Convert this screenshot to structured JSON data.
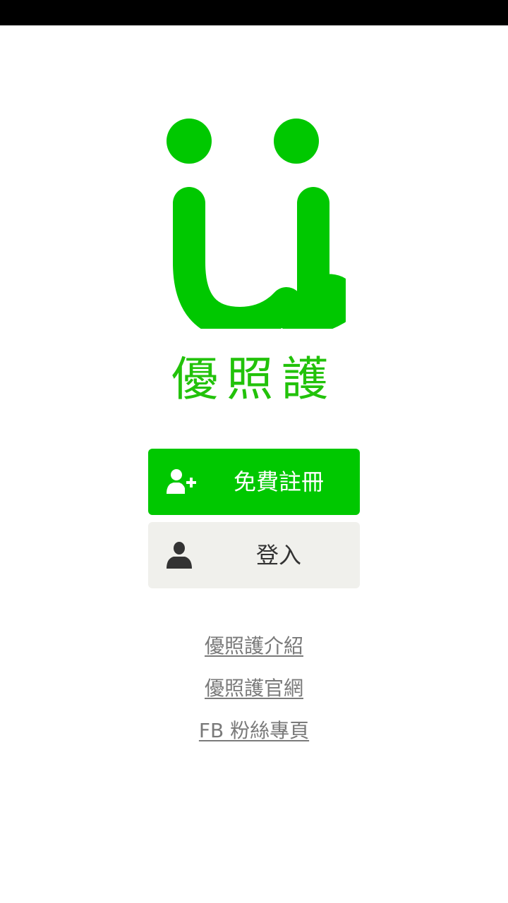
{
  "brand": {
    "logo_icon": "u-smile-logo-icon",
    "name": "優照護",
    "color": "#00c800"
  },
  "actions": {
    "register_label": "免費註冊",
    "register_icon": "add-user-icon",
    "login_label": "登入",
    "login_icon": "user-icon"
  },
  "links": {
    "intro": "優照護介紹",
    "website": "優照護官網",
    "fb_page": "FB 粉絲專頁"
  },
  "colors": {
    "primary": "#00c800",
    "secondary_bg": "#f0f0ec",
    "link": "#7a7a7a"
  }
}
